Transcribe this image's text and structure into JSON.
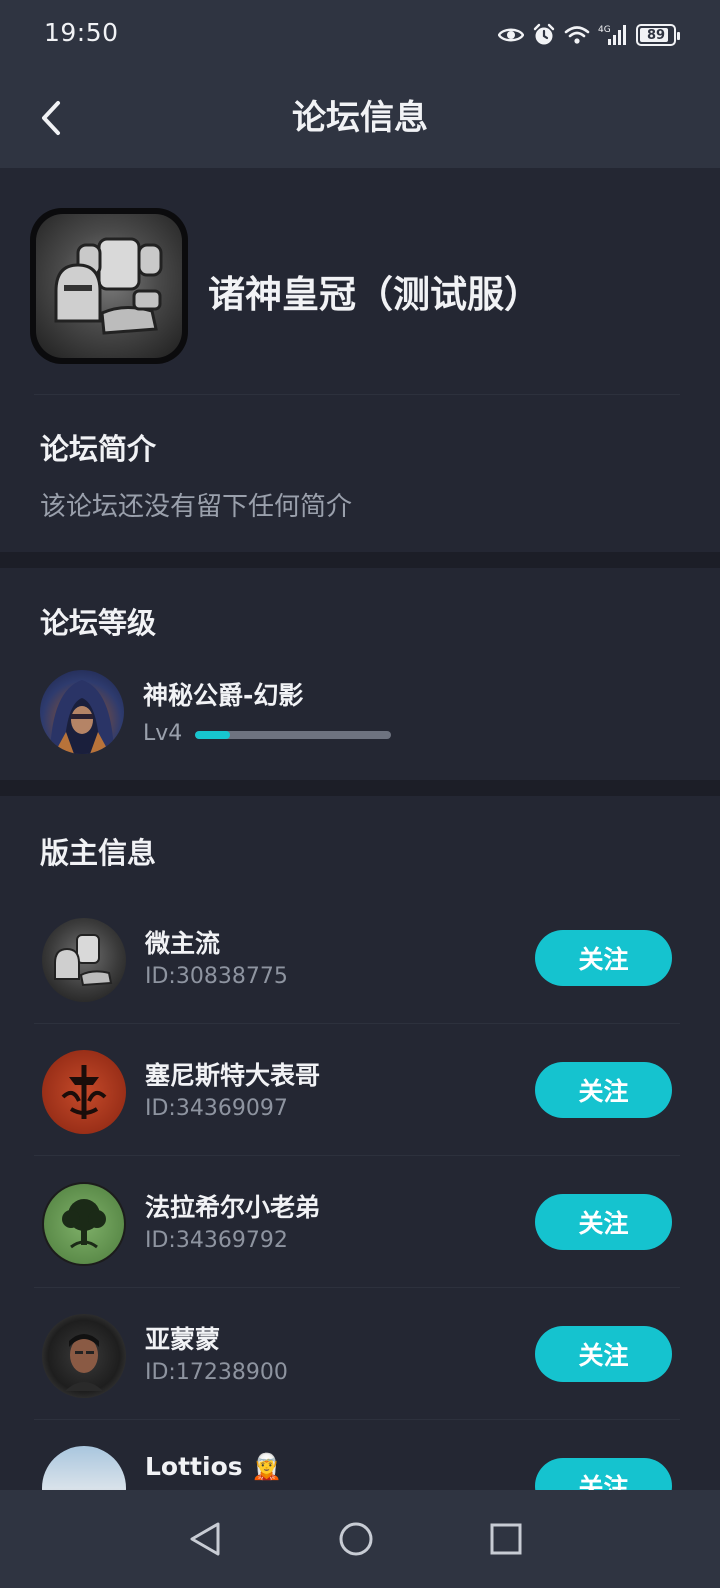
{
  "status_bar": {
    "time": "19:50",
    "network": "4G",
    "battery": 89,
    "icons": [
      "eye-icon",
      "alarm-icon",
      "wifi-icon",
      "signal-icon",
      "battery-icon"
    ]
  },
  "header": {
    "title": "论坛信息",
    "back_icon": "chevron-left-icon"
  },
  "forum": {
    "name": "诸神皇冠（测试服）",
    "icon": "armor-icon"
  },
  "intro": {
    "title": "论坛简介",
    "text": "该论坛还没有留下任何简介"
  },
  "level": {
    "title": "论坛等级",
    "name": "神秘公爵-幻影",
    "lv": "Lv4",
    "progress": 0.18
  },
  "moderators": {
    "title": "版主信息",
    "follow_label": "关注",
    "items": [
      {
        "name": "微主流",
        "id": "ID:30838775",
        "avatar": "armor-avatar"
      },
      {
        "name": "塞尼斯特大表哥",
        "id": "ID:34369097",
        "avatar": "red-emblem-avatar"
      },
      {
        "name": "法拉希尔小老弟",
        "id": "ID:34369792",
        "avatar": "tree-emblem-avatar"
      },
      {
        "name": "亚蒙蒙",
        "id": "ID:17238900",
        "avatar": "photo-avatar"
      },
      {
        "name": "Lottios 🧝",
        "id": "",
        "avatar": "landscape-avatar"
      }
    ]
  },
  "colors": {
    "accent": "#15c3cf",
    "background": "#242733",
    "header": "#2f3441"
  }
}
